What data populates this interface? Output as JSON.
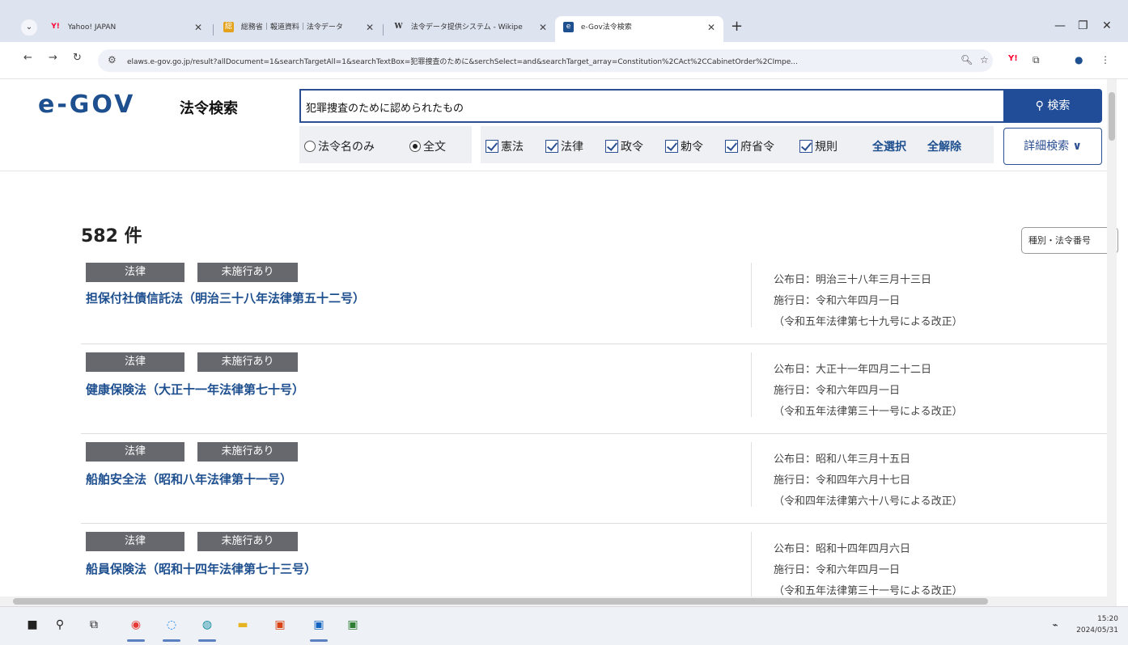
{
  "browser": {
    "tabs": [
      {
        "title": "Yahoo! JAPAN",
        "favicon": "yahoo-icon",
        "color": "#ff0033"
      },
      {
        "title": "総務省｜報道資料｜法令データ",
        "favicon": "soumu-icon",
        "color": "#e3a21a"
      },
      {
        "title": "法令データ提供システム - Wikipe",
        "favicon": "wikipedia-icon",
        "color": "#333333"
      },
      {
        "title": "e-Gov法令検索",
        "favicon": "egov-icon",
        "color": "#1e4f8f"
      }
    ],
    "url": "elaws.e-gov.go.jp/result?allDocument=1&searchTargetAll=1&searchTextBox=犯罪捜査のために&serchSelect=and&searchTarget_array=Constitution%2CAct%2CCabinetOrder%2CImpe..."
  },
  "site": {
    "logo": "e-GOV",
    "logo_sub": "法令検索",
    "search_value": "犯罪捜査のために認められたもの",
    "search_button": "検索",
    "scope_options": [
      "法令名のみ",
      "全文"
    ],
    "scope_selected": "全文",
    "categories": [
      {
        "label": "憲法",
        "checked": true
      },
      {
        "label": "法律",
        "checked": true
      },
      {
        "label": "政令",
        "checked": true
      },
      {
        "label": "勅令",
        "checked": true
      },
      {
        "label": "府省令",
        "checked": true
      },
      {
        "label": "規則",
        "checked": true
      }
    ],
    "select_all": "全選択",
    "clear_all": "全解除",
    "detail_search": "詳細検索"
  },
  "results": {
    "count": "582 件",
    "sort_label": "種別・法令番号",
    "items": [
      {
        "type": "法律",
        "status": "未施行あり",
        "title": "担保付社債信託法（明治三十八年法律第五十二号）",
        "promulgation": "公布日：明治三十八年三月十三日",
        "effective": "施行日：令和六年四月一日",
        "amendment": "（令和五年法律第七十九号による改正）"
      },
      {
        "type": "法律",
        "status": "未施行あり",
        "title": "健康保険法（大正十一年法律第七十号）",
        "promulgation": "公布日：大正十一年四月二十二日",
        "effective": "施行日：令和六年四月一日",
        "amendment": "（令和五年法律第三十一号による改正）"
      },
      {
        "type": "法律",
        "status": "未施行あり",
        "title": "船舶安全法（昭和八年法律第十一号）",
        "promulgation": "公布日：昭和八年三月十五日",
        "effective": "施行日：令和四年六月十七日",
        "amendment": "（令和四年法律第六十八号による改正）"
      },
      {
        "type": "法律",
        "status": "未施行あり",
        "title": "船員保険法（昭和十四年法律第七十三号）",
        "promulgation": "公布日：昭和十四年四月六日",
        "effective": "施行日：令和六年四月一日",
        "amendment": "（令和五年法律第三十一号による改正）"
      }
    ]
  },
  "taskbar": {
    "time": "15:20",
    "date": "2024/05/31"
  },
  "colors": {
    "accent": "#214c97",
    "link": "#1e4f8f",
    "tag_bg": "#66686e"
  }
}
